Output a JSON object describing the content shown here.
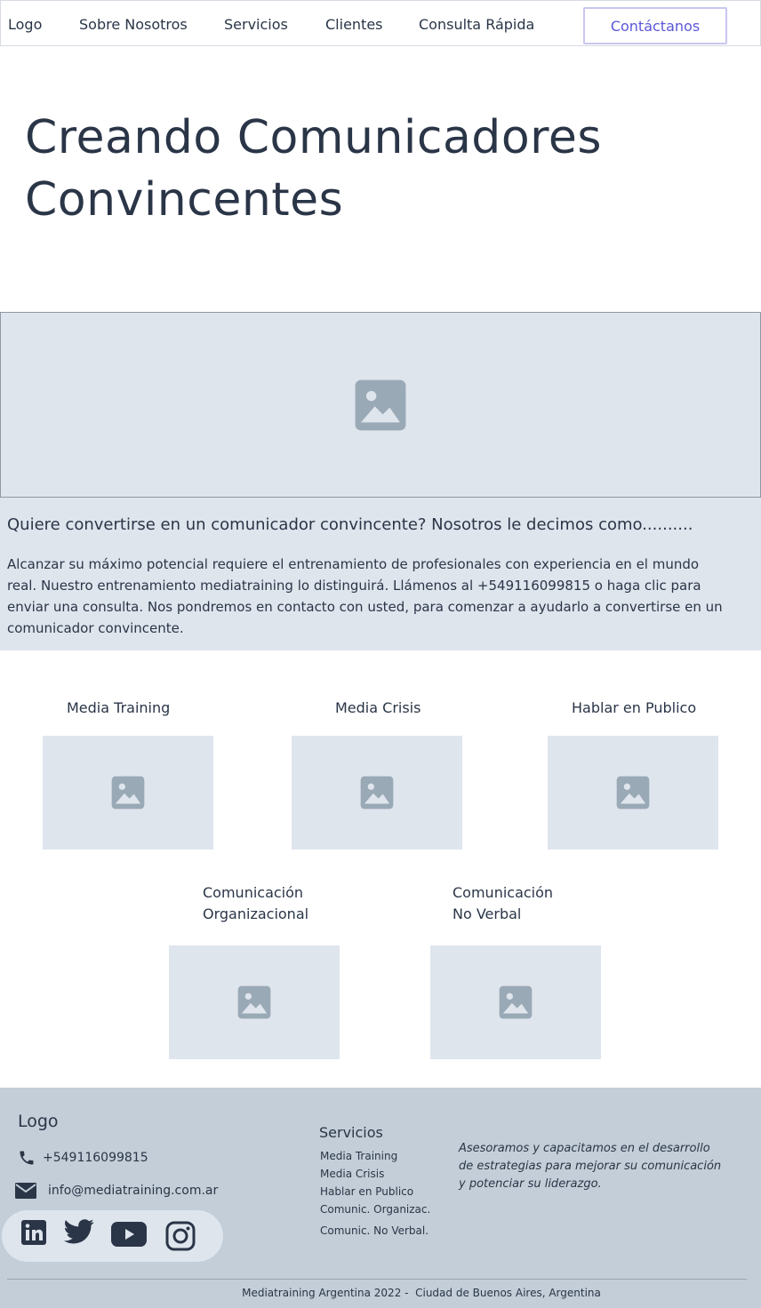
{
  "nav": {
    "logo": "Logo",
    "items": [
      "Sobre Nosotros",
      "Servicios",
      "Clientes",
      "Consulta Rápida"
    ],
    "cta": "Contáctanos"
  },
  "hero": {
    "title": "Creando Comunicadores Convincentes",
    "image_icon": "image-placeholder-icon"
  },
  "intro": {
    "question": "Quiere convertirse en un comunicador convincente? Nosotros le decimos como..........",
    "paragraph": "Alcanzar su máximo potencial requiere el entrenamiento de profesionales con experiencia en el mundo real. Nuestro entrenamiento mediatraining lo distinguirá. Llámenos al +549116099815 o haga clic  para enviar una consulta. Nos pondremos en contacto con usted, para comenzar a ayudarlo a convertirse en un comunicador convincente."
  },
  "services": [
    {
      "label": "Media Training"
    },
    {
      "label": "Media Crisis"
    },
    {
      "label": "Hablar en Publico"
    },
    {
      "label_line1": "Comunicación",
      "label_line2": "Organizacional"
    },
    {
      "label_line1": "Comunicación",
      "label_line2": "No Verbal"
    }
  ],
  "footer": {
    "logo": "Logo",
    "phone": "+549116099815",
    "email": "info@mediatraining.com.ar",
    "social": [
      "linkedin-icon",
      "twitter-icon",
      "youtube-icon",
      "instagram-icon"
    ],
    "services_title": "Servicios",
    "services": [
      "Media Training",
      "Media Crisis",
      "Hablar en Publico",
      "Comunic. Organizac.",
      "Comunic. No Verbal."
    ],
    "description": "Asesoramos y capacitamos en el desarrollo de estrategias para mejorar su comunicación y potenciar su liderazgo.",
    "copyright": "Mediatraining Argentina 2022 -  Ciudad de Buenos Aires, Argentina"
  },
  "colors": {
    "text": "#2a3547",
    "accent": "#5b57d8",
    "placeholder_bg": "#dfe5ed",
    "placeholder_icon": "#9aa9b6",
    "footer_bg": "#c3ced8"
  }
}
